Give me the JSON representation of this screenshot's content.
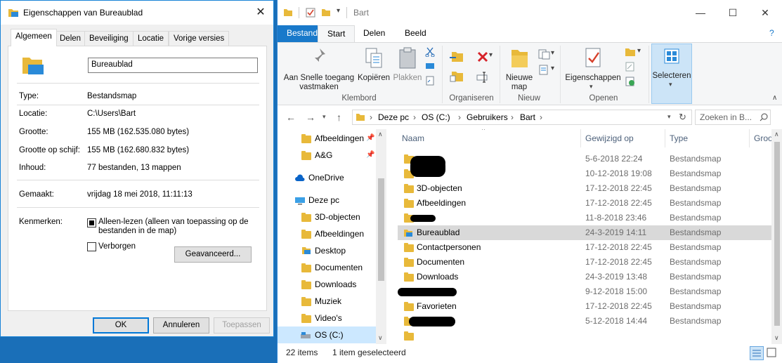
{
  "dialog": {
    "title": "Eigenschappen van Bureaublad",
    "close_glyph": "✕",
    "tabs": [
      "Algemeen",
      "Delen",
      "Beveiliging",
      "Locatie",
      "Vorige versies"
    ],
    "folder_name": "Bureaublad",
    "props": [
      {
        "label": "Type:",
        "value": "Bestandsmap"
      },
      {
        "label": "Locatie:",
        "value": "C:\\Users\\Bart"
      },
      {
        "label": "Grootte:",
        "value": "155 MB (162.535.080 bytes)"
      },
      {
        "label": "Grootte op schijf:",
        "value": "155 MB (162.680.832 bytes)"
      },
      {
        "label": "Inhoud:",
        "value": "77 bestanden, 13 mappen"
      },
      {
        "label": "Gemaakt:",
        "value": "vrijdag 18 mei 2018, 11:11:13"
      }
    ],
    "attributes_label": "Kenmerken:",
    "readonly_label": "Alleen-lezen (alleen van toepassing op de bestanden in de map)",
    "readonly_line1": "Alleen-lezen (alleen van toepassing op de",
    "readonly_line2": "bestanden in de map)",
    "readonly_checked": true,
    "hidden_label": "Verborgen",
    "hidden_checked": false,
    "advanced_button": "Geavanceerd...",
    "ok_button": "OK",
    "cancel_button": "Annuleren",
    "apply_button": "Toepassen"
  },
  "explorer": {
    "title": "Bart",
    "window_controls": {
      "minimize": "—",
      "maximize": "☐",
      "close": "✕"
    },
    "ribbon_tabs": [
      "Bestand",
      "Start",
      "Delen",
      "Beeld"
    ],
    "ribbon": {
      "pin_line1": "Aan Snelle toegang",
      "pin_line2": "vastmaken",
      "copy": "Kopiëren",
      "paste": "Plakken",
      "clipboard_group": "Klembord",
      "organize_group": "Organiseren",
      "new_folder_line1": "Nieuwe",
      "new_folder_line2": "map",
      "new_group": "Nieuw",
      "properties": "Eigenschappen",
      "open_group": "Openen",
      "select": "Selecteren"
    },
    "breadcrumb": [
      "Deze pc",
      "OS (C:)",
      "Gebruikers",
      "Bart"
    ],
    "search_placeholder": "Zoeken in B...",
    "nav": [
      {
        "label": "Afbeeldingen",
        "pinned": true
      },
      {
        "label": "A&G",
        "pinned": true
      },
      {
        "label": "OneDrive"
      },
      {
        "label": "Deze pc"
      },
      {
        "label": "3D-objecten"
      },
      {
        "label": "Afbeeldingen"
      },
      {
        "label": "Desktop"
      },
      {
        "label": "Documenten"
      },
      {
        "label": "Downloads"
      },
      {
        "label": "Muziek"
      },
      {
        "label": "Video's"
      },
      {
        "label": "OS (C:)"
      }
    ],
    "columns": {
      "name": "Naam",
      "modified": "Gewijzigd op",
      "type": "Type",
      "size": "Groo"
    },
    "files": [
      {
        "name": "",
        "date": "5-6-2018 22:24",
        "type": "Bestandsmap",
        "redacted": true
      },
      {
        "name": "",
        "date": "10-12-2018 19:08",
        "type": "Bestandsmap",
        "redacted": true
      },
      {
        "name": "3D-objecten",
        "date": "17-12-2018 22:45",
        "type": "Bestandsmap"
      },
      {
        "name": "Afbeeldingen",
        "date": "17-12-2018 22:45",
        "type": "Bestandsmap"
      },
      {
        "name": "",
        "date": "11-8-2018 23:46",
        "type": "Bestandsmap",
        "redacted": true
      },
      {
        "name": "Bureaublad",
        "date": "24-3-2019 14:11",
        "type": "Bestandsmap",
        "selected": true
      },
      {
        "name": "Contactpersonen",
        "date": "17-12-2018 22:45",
        "type": "Bestandsmap"
      },
      {
        "name": "Documenten",
        "date": "17-12-2018 22:45",
        "type": "Bestandsmap"
      },
      {
        "name": "Downloads",
        "date": "24-3-2019 13:48",
        "type": "Bestandsmap"
      },
      {
        "name": "",
        "date": "9-12-2018 15:00",
        "type": "Bestandsmap",
        "redacted": true
      },
      {
        "name": "Favorieten",
        "date": "17-12-2018 22:45",
        "type": "Bestandsmap"
      },
      {
        "name": "",
        "date": "5-12-2018 14:44",
        "type": "Bestandsmap",
        "redacted": true
      }
    ],
    "status_items": "22 items",
    "status_selected": "1 item geselecteerd"
  },
  "colors": {
    "accent": "#0078d7",
    "folder": "#e8b93a",
    "selection": "#d9d9d9"
  }
}
